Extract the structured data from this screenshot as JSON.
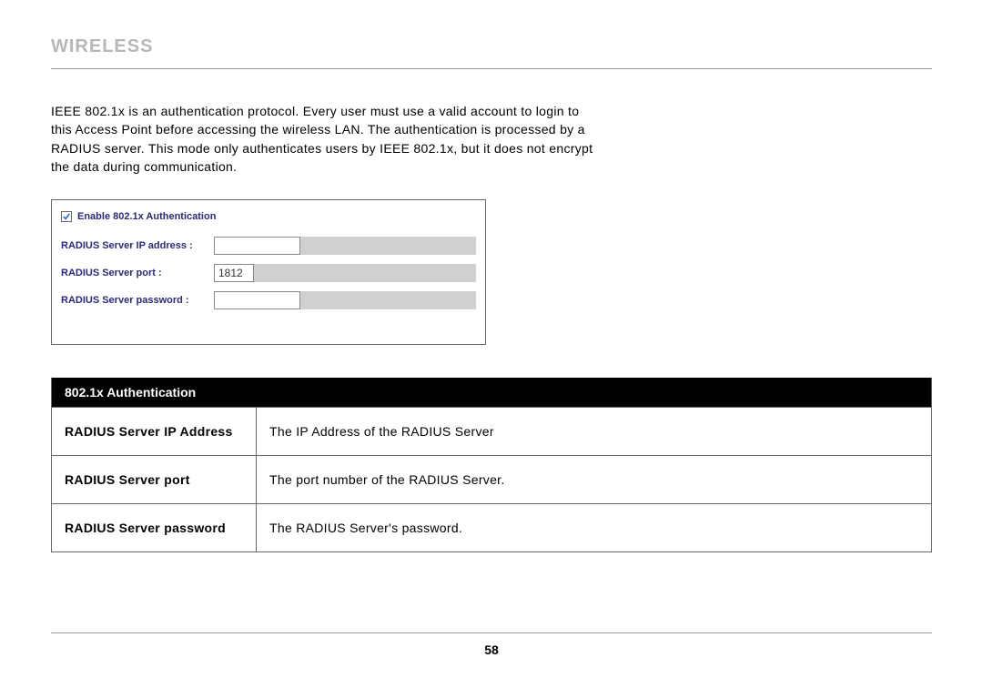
{
  "page_title": "WIRELESS",
  "intro": "IEEE 802.1x is an authentication protocol. Every user must use a valid account to login to this Access Point before accessing the wireless LAN. The authentication is processed by a RADIUS server. This mode only authenticates users by IEEE 802.1x, but it does not encrypt the data during communication.",
  "form": {
    "enable_label": "Enable 802.1x Authentication",
    "enable_checked": true,
    "rows": [
      {
        "label": "RADIUS Server IP address :",
        "value": "",
        "cls": "input-ip"
      },
      {
        "label": "RADIUS Server port :",
        "value": "1812",
        "cls": "input-port"
      },
      {
        "label": "RADIUS Server password :",
        "value": "",
        "cls": "input-pw"
      }
    ]
  },
  "desc_table": {
    "header": "802.1x Authentication",
    "rows": [
      {
        "k": "RADIUS Server IP Address",
        "v": "The IP Address of the RADIUS Server"
      },
      {
        "k": "RADIUS Server port",
        "v": "The port number of the RADIUS Server."
      },
      {
        "k": "RADIUS Server password",
        "v": "The RADIUS Server's password."
      }
    ]
  },
  "page_number": "58"
}
